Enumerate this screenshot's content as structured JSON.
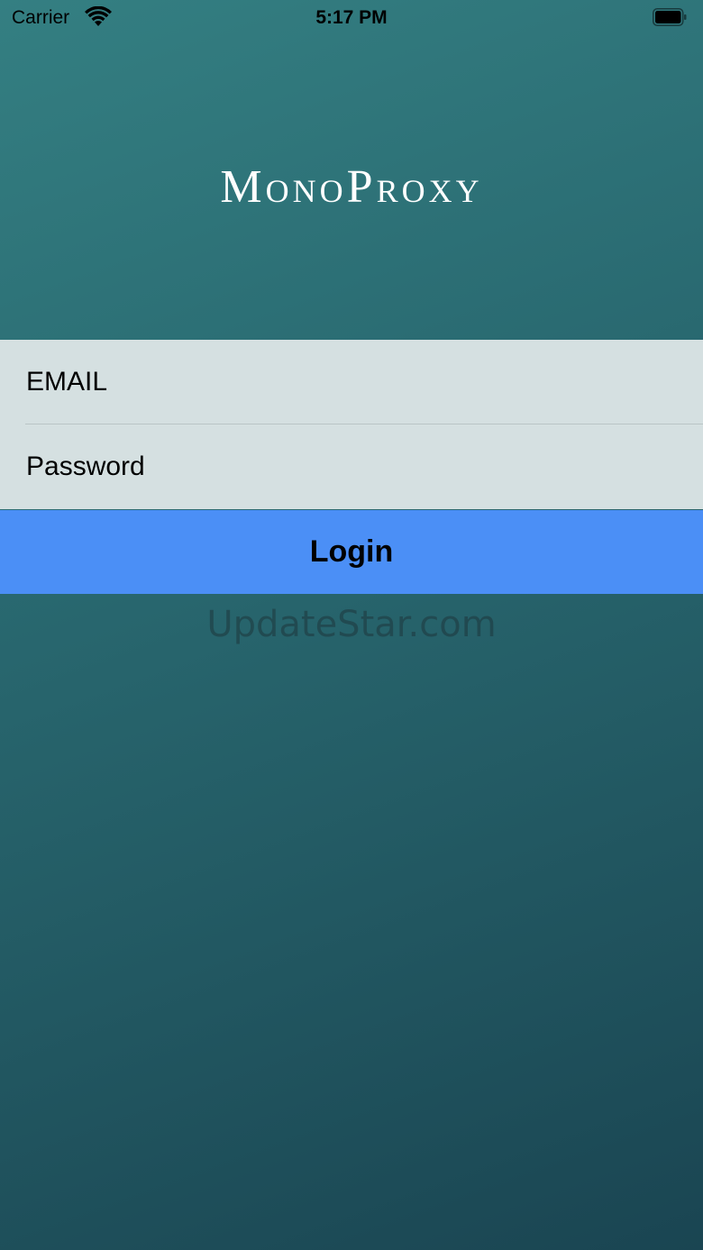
{
  "status_bar": {
    "carrier": "Carrier",
    "time": "5:17 PM",
    "wifi_icon": "wifi-icon",
    "battery_icon": "battery-icon"
  },
  "app": {
    "logo_text": "MonoProxy"
  },
  "login_form": {
    "email_placeholder": "EMAIL",
    "email_value": "",
    "password_placeholder": "Password",
    "password_value": "",
    "login_label": "Login"
  },
  "watermark": "UpdateStar.com",
  "colors": {
    "background_top": "#347f82",
    "background_bottom": "#1a4552",
    "form_background": "#d5e0e1",
    "button_background": "#4b8ff6"
  }
}
